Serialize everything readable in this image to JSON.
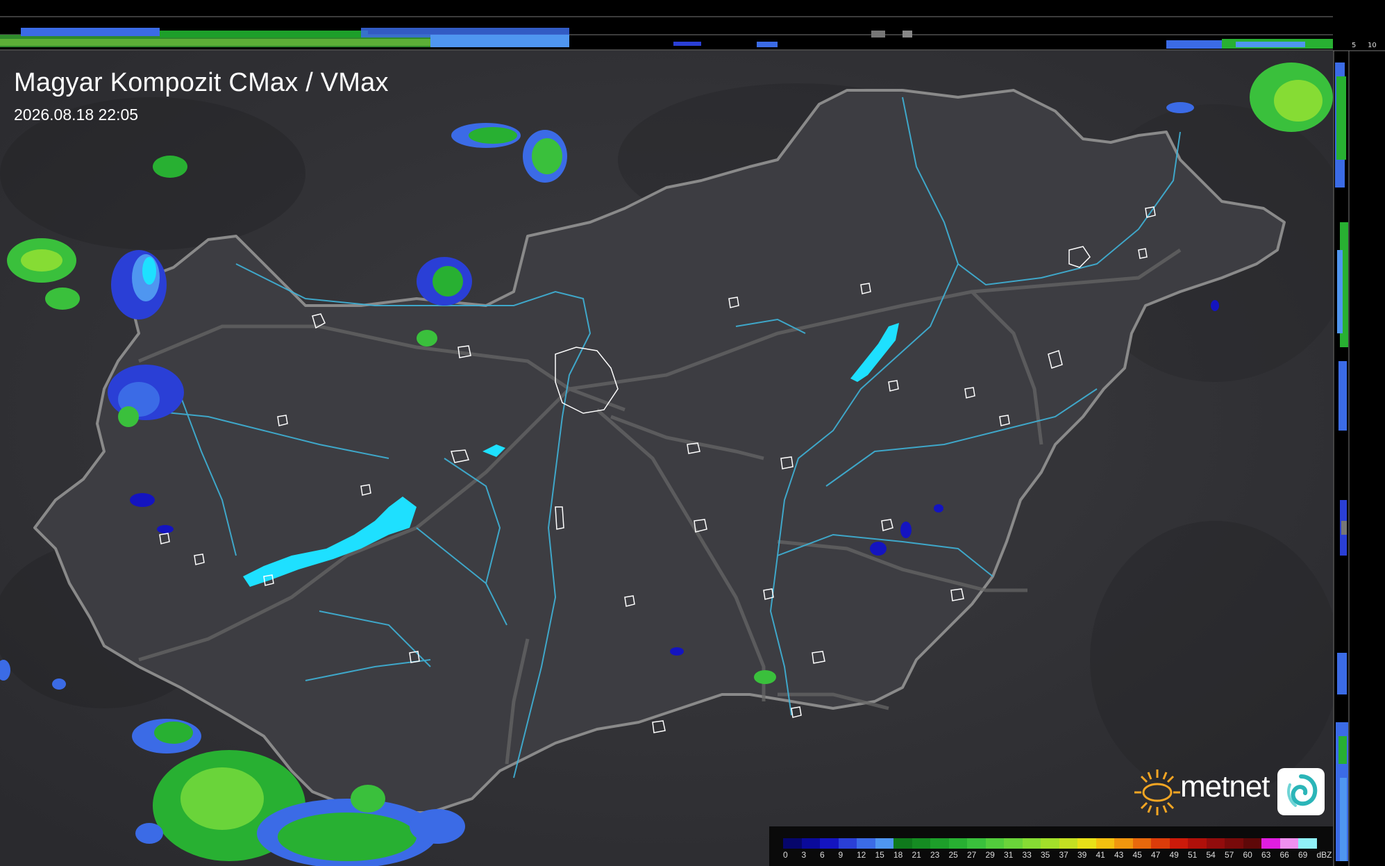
{
  "map": {
    "title": "Magyar Kompozit CMax / VMax",
    "timestamp": "2026.08.18 22:05"
  },
  "side_profile": {
    "top_ticks": [
      "10",
      "5"
    ],
    "right_ticks": [
      "5",
      "10"
    ]
  },
  "brand": {
    "name": "metnet",
    "sun_color": "#f5a623",
    "logo_icon": "swirl-icon"
  },
  "legend": {
    "unit": "dBZ",
    "values": [
      "0",
      "3",
      "6",
      "9",
      "12",
      "15",
      "18",
      "21",
      "23",
      "25",
      "27",
      "29",
      "31",
      "33",
      "35",
      "37",
      "39",
      "41",
      "43",
      "45",
      "47",
      "49",
      "51",
      "54",
      "57",
      "60",
      "63",
      "66",
      "69"
    ],
    "colors": [
      "#06066b",
      "#0a0a9a",
      "#1414c0",
      "#2a3fd6",
      "#3b6be6",
      "#4f96f0",
      "#0f7a1c",
      "#158c22",
      "#1d9f2a",
      "#28b032",
      "#3ac03c",
      "#52cc3c",
      "#6ad43a",
      "#86dc34",
      "#a2e02a",
      "#c4e022",
      "#e8e018",
      "#f4c010",
      "#f0960e",
      "#e8680c",
      "#dc3c0a",
      "#cc1a0a",
      "#b0100a",
      "#920c0c",
      "#780a0a",
      "#5e0808",
      "#e01ee0",
      "#f090f0",
      "#90f0f8"
    ]
  },
  "colors": {
    "background": "#3a3a3f",
    "country_border": "#8a8a8a",
    "rivers": "#3fb3d8",
    "lakes": "#1ee0ff",
    "cities": "#ffffff"
  }
}
